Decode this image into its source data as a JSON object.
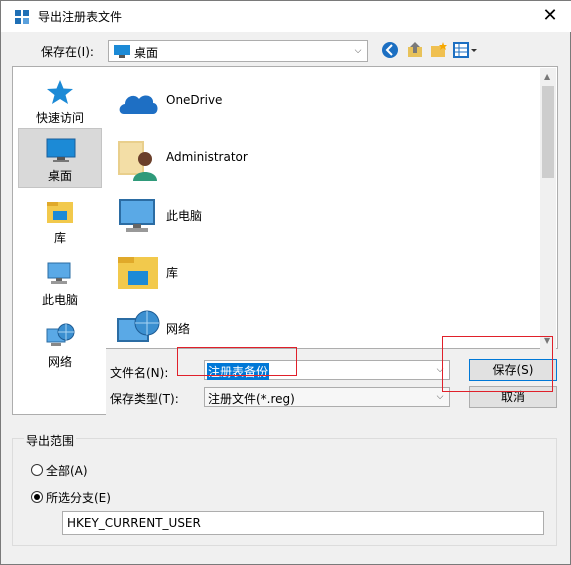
{
  "window": {
    "title": "导出注册表文件",
    "close_glyph": "✕"
  },
  "save_in": {
    "label": "保存在(I):",
    "value": "桌面"
  },
  "toolbar": {
    "back": "back-icon",
    "up": "up-folder-icon",
    "new_folder": "new-folder-icon",
    "view": "view-menu-icon"
  },
  "sidebar": {
    "items": [
      {
        "label": "快速访问",
        "icon": "star-icon"
      },
      {
        "label": "桌面",
        "icon": "desktop-icon",
        "selected": true
      },
      {
        "label": "库",
        "icon": "library-icon"
      },
      {
        "label": "此电脑",
        "icon": "computer-icon"
      },
      {
        "label": "网络",
        "icon": "network-icon"
      }
    ]
  },
  "files": {
    "items": [
      {
        "label": "OneDrive",
        "icon": "onedrive-icon"
      },
      {
        "label": "Administrator",
        "icon": "user-folder-icon"
      },
      {
        "label": "此电脑",
        "icon": "computer-icon"
      },
      {
        "label": "库",
        "icon": "library-icon"
      },
      {
        "label": "网络",
        "icon": "network-icon"
      }
    ]
  },
  "filename": {
    "label": "文件名(N):",
    "value": "注册表备份"
  },
  "filetype": {
    "label": "保存类型(T):",
    "value": "注册文件(*.reg)"
  },
  "buttons": {
    "save": "保存(S)",
    "cancel": "取消"
  },
  "export_range": {
    "title": "导出范围",
    "all": "全部(A)",
    "branch": "所选分支(E)",
    "branch_value": "HKEY_CURRENT_USER",
    "selected": "branch"
  },
  "colors": {
    "accent": "#0078d7",
    "highlight_box": "#e0202a",
    "selection": "#d9d9d9"
  }
}
